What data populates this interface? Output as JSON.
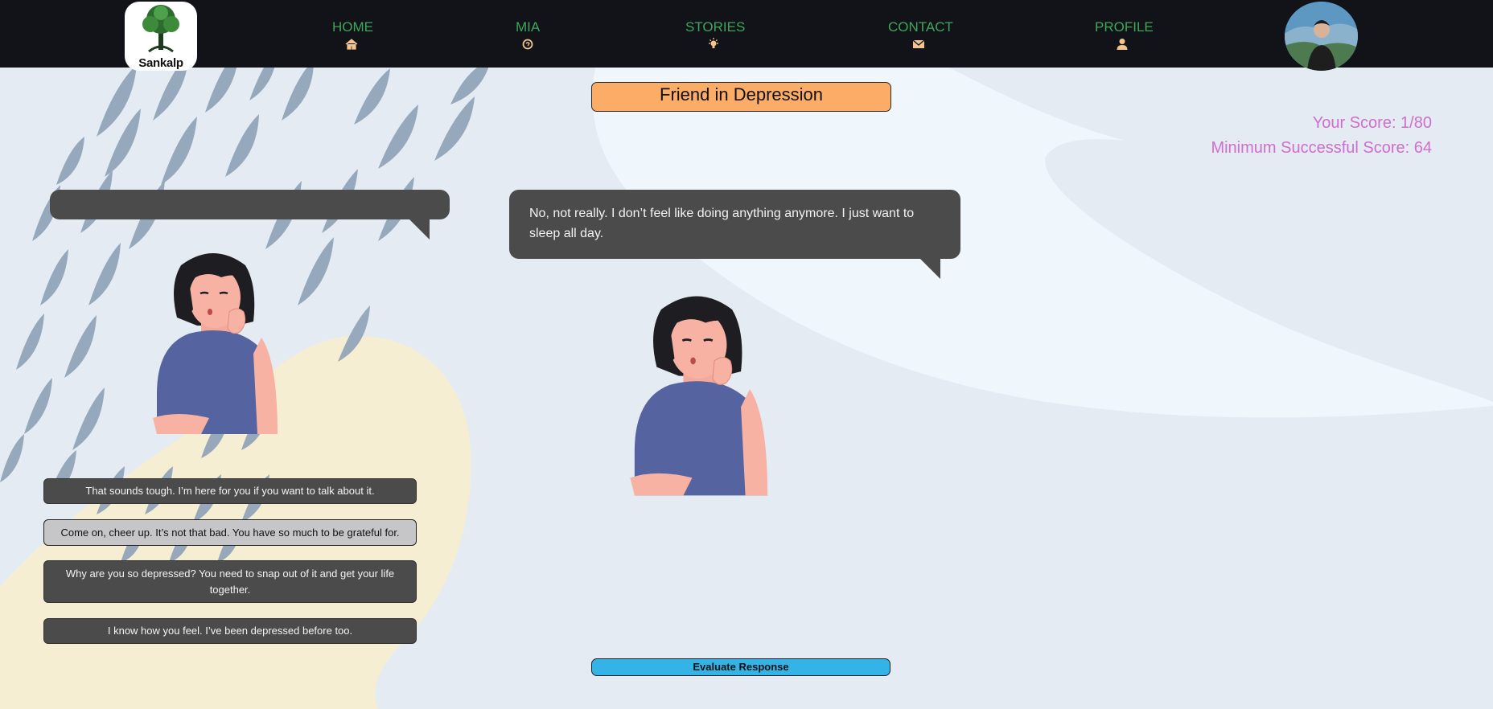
{
  "nav": {
    "logo_text": "Sankalp",
    "items": [
      {
        "label": "HOME",
        "icon": "home-icon"
      },
      {
        "label": "MIA",
        "icon": "brain-icon"
      },
      {
        "label": "STORIES",
        "icon": "lightbulb-icon"
      },
      {
        "label": "CONTACT",
        "icon": "envelope-icon"
      },
      {
        "label": "PROFILE",
        "icon": "user-icon"
      }
    ]
  },
  "scenario": {
    "title": "Friend in Depression"
  },
  "score": {
    "current": "Your Score: 1/80",
    "minimum": "Minimum Successful Score: 64"
  },
  "dialogue": {
    "player_bubble": "",
    "friend_bubble": "No, not really. I don’t feel like doing anything anymore. I just want to sleep all day."
  },
  "options": [
    {
      "label": "That sounds tough. I’m here for you if you want to talk about it.",
      "selected": false
    },
    {
      "label": "Come on, cheer up. It’s not that bad. You have so much to be grateful for.",
      "selected": true
    },
    {
      "label": "Why are you so depressed? You need to snap out of it and get your life together.",
      "selected": false
    },
    {
      "label": "I know how you feel. I’ve been depressed before too.",
      "selected": false
    }
  ],
  "actions": {
    "evaluate_label": "Evaluate Response"
  },
  "colors": {
    "nav_bg": "#111318",
    "nav_text": "#3fa65a",
    "nav_icon": "#f3c58e",
    "title_bg": "#fbad68",
    "score_text": "#cf6ecf",
    "bubble_bg": "#4b4b4b",
    "option_selected_bg": "#c6c6c8",
    "evaluate_bg": "#33b3e6"
  }
}
